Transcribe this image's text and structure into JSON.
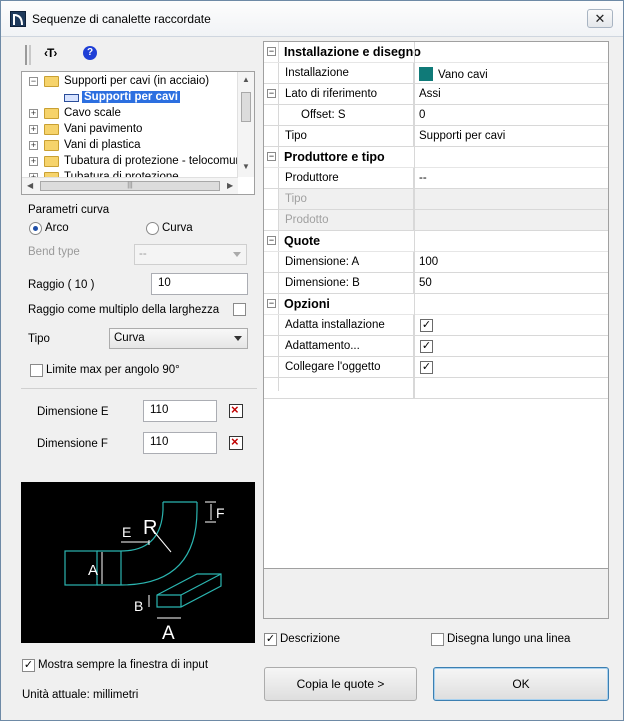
{
  "window": {
    "title": "Sequenze di canalette raccordate",
    "close_glyph": "✕"
  },
  "toolbar": {
    "text_tool_label": "‹T›",
    "help_glyph": "?"
  },
  "tree": {
    "items": [
      {
        "label": "Supporti per cavi (in acciaio)",
        "expander": "−",
        "level": 0,
        "type": "folder"
      },
      {
        "label": "Supporti per cavi",
        "expander": "",
        "level": 1,
        "type": "item",
        "selected": true
      },
      {
        "label": "Cavo scale",
        "expander": "+",
        "level": 0,
        "type": "folder"
      },
      {
        "label": "Vani pavimento",
        "expander": "+",
        "level": 0,
        "type": "folder"
      },
      {
        "label": "Vani di plastica",
        "expander": "+",
        "level": 0,
        "type": "folder"
      },
      {
        "label": "Tubatura di protezione - telocomunic",
        "expander": "+",
        "level": 0,
        "type": "folder"
      },
      {
        "label": "Tubatura di protezione",
        "expander": "+",
        "level": 0,
        "type": "folder"
      }
    ],
    "scroll_up": "▲",
    "scroll_down": "▼",
    "scroll_left": "◀",
    "scroll_right": "▶",
    "thumb_grip": "|||"
  },
  "curve_params": {
    "group_title": "Parametri curva",
    "radio_arco": "Arco",
    "radio_curva": "Curva",
    "selected_radio": "Arco",
    "bend_type_label": "Bend type",
    "bend_type_value": "--",
    "raggio_label": "Raggio ( 10 )",
    "raggio_value": "10",
    "raggio_multiplo_label": "Raggio come multiplo della larghezza",
    "raggio_multiplo_checked": false,
    "tipo_label": "Tipo",
    "tipo_value": "Curva",
    "limite_label": "Limite max per angolo 90°",
    "limite_checked": false
  },
  "dimensions": {
    "e_label": "Dimensione E",
    "e_value": "110",
    "f_label": "Dimensione F",
    "f_value": "110"
  },
  "preview": {
    "labels": {
      "e": "E",
      "r": "R",
      "f": "F",
      "a": "A",
      "b": "B",
      "a2": "A"
    },
    "line_color": "#2bb5b0",
    "label_color": "#ffffff"
  },
  "bottom_left": {
    "mostra_label": "Mostra sempre la finestra di input",
    "mostra_checked": true,
    "unit_text": "Unità attuale: millimetri"
  },
  "property_grid": {
    "rows": [
      {
        "kind": "category",
        "name": "Installazione e disegno",
        "toggle": "−"
      },
      {
        "kind": "prop",
        "name": "Installazione",
        "value": "Vano cavi",
        "swatch": "#0f7a78"
      },
      {
        "kind": "subcategory",
        "name": "Lato di riferimento",
        "value": "Assi",
        "toggle": "−"
      },
      {
        "kind": "prop",
        "name": "Offset: S",
        "value": "0",
        "indent": true
      },
      {
        "kind": "prop",
        "name": "Tipo",
        "value": "Supporti per cavi"
      },
      {
        "kind": "category",
        "name": "Produttore e tipo",
        "toggle": "−"
      },
      {
        "kind": "prop",
        "name": "Produttore",
        "value": "--"
      },
      {
        "kind": "prop",
        "name": "Tipo",
        "value": "",
        "disabled": true
      },
      {
        "kind": "prop",
        "name": "Prodotto",
        "value": "",
        "disabled": true
      },
      {
        "kind": "category",
        "name": "Quote",
        "toggle": "−"
      },
      {
        "kind": "prop",
        "name": "Dimensione: A",
        "value": "100"
      },
      {
        "kind": "prop",
        "name": "Dimensione: B",
        "value": "50"
      },
      {
        "kind": "category",
        "name": "Opzioni",
        "toggle": "−"
      },
      {
        "kind": "check",
        "name": "Adatta installazione",
        "checked": true
      },
      {
        "kind": "check",
        "name": "Adattamento...",
        "checked": true
      },
      {
        "kind": "check",
        "name": "Collegare l'oggetto",
        "checked": true
      },
      {
        "kind": "prop",
        "name": "",
        "value": ""
      }
    ],
    "check_glyph": "✓"
  },
  "options": {
    "descrizione_label": "Descrizione",
    "descrizione_checked": true,
    "disegna_label": "Disegna lungo una linea",
    "disegna_checked": false
  },
  "buttons": {
    "copia_label": "Copia le quote >",
    "ok_label": "OK"
  }
}
